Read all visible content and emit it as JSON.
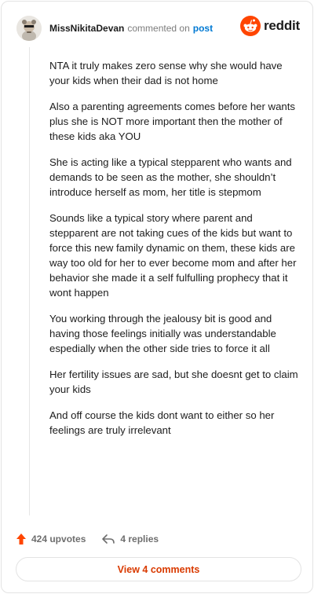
{
  "comment": {
    "username": "MissNikitaDevan",
    "commented_on": "commented on",
    "post_link": "post",
    "paragraphs": [
      "NTA it truly makes zero sense why she would have your kids when their dad is not home",
      "Also a parenting agreements comes before her wants plus she is NOT more important then the mother of these kids aka YOU",
      "She is acting like a typical stepparent who wants and demands to be seen as the mother, she shouldn’t introduce herself as mom, her title is stepmom",
      "Sounds like a typical story where parent and stepparent are not taking cues of the kids but want to force this new family dynamic on them, these kids are way too old for her to ever become mom and after her behavior she made it a self fulfulling prophecy that it wont happen",
      "You working through the jealousy bit is good and having those feelings initially was understandable espedially when the other side tries to force it all",
      "Her fertility issues are sad, but she doesnt get to claim your kids",
      "And off course the kids dont want to either so her feelings are truly irrelevant"
    ]
  },
  "brand": {
    "name": "reddit",
    "color": "#ff4500"
  },
  "footer": {
    "upvotes": "424 upvotes",
    "replies": "4 replies",
    "view_comments": "View 4 comments"
  },
  "icons": {
    "avatar": "avatar-icon",
    "logo": "reddit-logo-icon",
    "upvote": "upvote-arrow-icon",
    "reply": "reply-arrow-icon"
  },
  "colors": {
    "link": "#0079d3",
    "upvote": "#ff4500",
    "view_button": "#d93a00"
  }
}
